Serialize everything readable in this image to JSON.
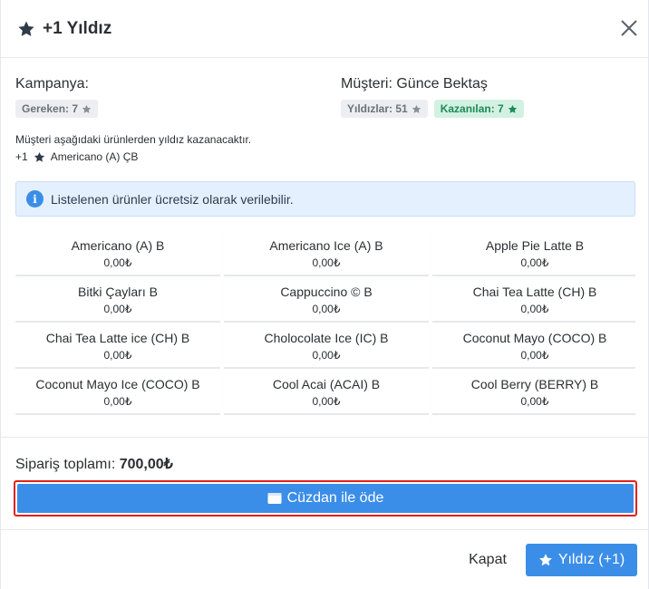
{
  "header": {
    "title": "+1 Yıldız"
  },
  "campaign": {
    "label": "Kampanya:",
    "required_badge": "Gereken: 7"
  },
  "customer": {
    "label": "Müşteri: Günce Bektaş",
    "stars_badge": "Yıldızlar: 51",
    "earned_badge": "Kazanılan: 7"
  },
  "info": {
    "text": "Müşteri aşağıdaki ürünlerden yıldız kazanacaktır.",
    "reward_prefix": "+1",
    "reward_product": "Americano (A) ÇB"
  },
  "alert": {
    "text": "Listelenen ürünler ücretsiz olarak verilebilir."
  },
  "products": [
    {
      "name": "Americano (A) B",
      "price": "0,00₺"
    },
    {
      "name": "Americano Ice (A) B",
      "price": "0,00₺"
    },
    {
      "name": "Apple Pie Latte B",
      "price": "0,00₺"
    },
    {
      "name": "Bitki Çayları B",
      "price": "0,00₺"
    },
    {
      "name": "Cappuccino © B",
      "price": "0,00₺"
    },
    {
      "name": "Chai Tea Latte (CH) B",
      "price": "0,00₺"
    },
    {
      "name": "Chai Tea Latte ice (CH) B",
      "price": "0,00₺"
    },
    {
      "name": "Cholocolate Ice (IC) B",
      "price": "0,00₺"
    },
    {
      "name": "Coconut Mayo (COCO) B",
      "price": "0,00₺"
    },
    {
      "name": "Coconut Mayo Ice (COCO) B",
      "price": "0,00₺"
    },
    {
      "name": "Cool Acai (ACAI) B",
      "price": "0,00₺"
    },
    {
      "name": "Cool Berry (BERRY) B",
      "price": "0,00₺"
    },
    {
      "name": "",
      "price": ""
    },
    {
      "name": "",
      "price": ""
    },
    {
      "name": "",
      "price": ""
    }
  ],
  "order": {
    "total_label": "Sipariş toplamı:",
    "total_value": "700,00₺"
  },
  "buttons": {
    "wallet": "Cüzdan ile öde",
    "close": "Kapat",
    "star": "Yıldız (+1)"
  },
  "colors": {
    "primary": "#3b8ee8",
    "highlight_outline": "#e0211c",
    "earned_bg": "#d3f1e2"
  },
  "icons": {
    "title": "star-icon",
    "close": "close-icon",
    "info": "info-icon",
    "wallet": "wallet-icon"
  }
}
